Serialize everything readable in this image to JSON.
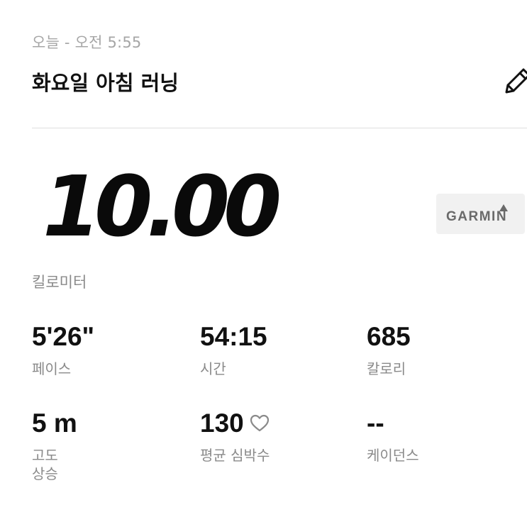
{
  "header": {
    "timestamp": "오늘 - 오전 5:55",
    "title": "화요일 아침 러닝",
    "edit_icon": "pencil-icon"
  },
  "summary": {
    "distance": "10.00",
    "distance_unit": "킬로미터",
    "device_brand": "GARMIN"
  },
  "stats": [
    {
      "value": "5'26\"",
      "label": "페이스"
    },
    {
      "value": "54:15",
      "label": "시간"
    },
    {
      "value": "685",
      "label": "칼로리"
    },
    {
      "value": "5 m",
      "label": "고도\n상승"
    },
    {
      "value": "130",
      "label": "평균 심박수",
      "icon": "heart-icon"
    },
    {
      "value": "--",
      "label": "케이던스"
    }
  ],
  "colors": {
    "text_primary": "#111111",
    "text_secondary": "#8a8a8a",
    "timestamp": "#a6a6a6",
    "divider": "#dedede",
    "badge_bg": "#f1f1f1"
  }
}
